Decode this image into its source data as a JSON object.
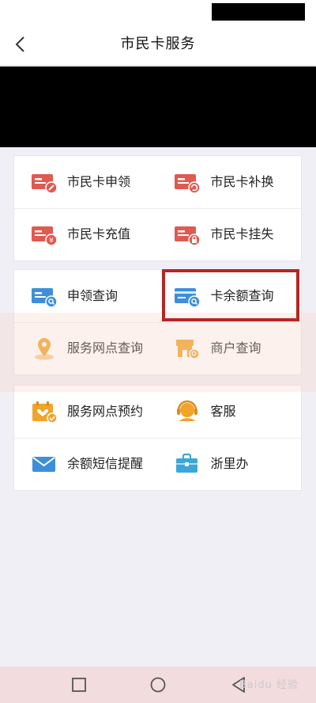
{
  "header": {
    "title": "市民卡服务"
  },
  "colors": {
    "icon_red": "#e05a4f",
    "icon_blue": "#3d8fdb",
    "icon_orange": "#f0a42a",
    "highlight": "#b62525"
  },
  "group1": [
    {
      "label": "市民卡申领",
      "icon": "card-apply-icon"
    },
    {
      "label": "市民卡补换",
      "icon": "card-replace-icon"
    },
    {
      "label": "市民卡充值",
      "icon": "card-recharge-icon"
    },
    {
      "label": "市民卡挂失",
      "icon": "card-lock-icon"
    }
  ],
  "group2": [
    {
      "label": "申领查询",
      "icon": "apply-query-icon"
    },
    {
      "label": "卡余额查询",
      "icon": "balance-query-icon"
    },
    {
      "label": "服务网点查询",
      "icon": "location-pin-icon"
    },
    {
      "label": "商户查询",
      "icon": "merchant-icon"
    }
  ],
  "group3": [
    {
      "label": "服务网点预约",
      "icon": "calendar-check-icon"
    },
    {
      "label": "客服",
      "icon": "customer-service-icon"
    },
    {
      "label": "余额短信提醒",
      "icon": "mail-icon"
    },
    {
      "label": "浙里办",
      "icon": "briefcase-icon"
    }
  ],
  "watermark": "Baidu 经验"
}
